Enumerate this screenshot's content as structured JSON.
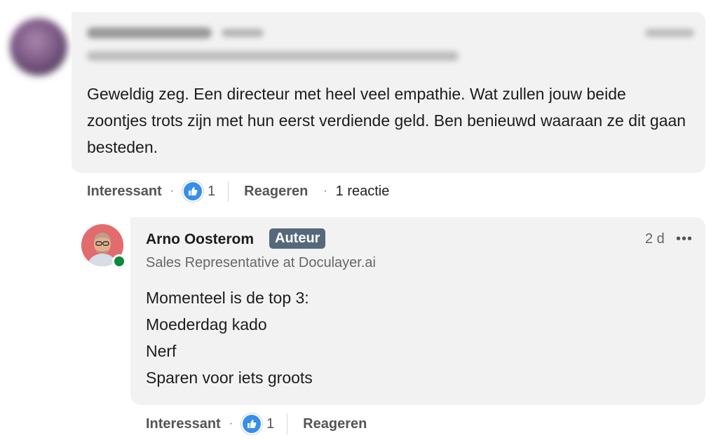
{
  "comment": {
    "text": "Geweldig zeg. Een directeur met heel veel empathie. Wat zullen jouw beide zoontjes trots zijn met hun eerst verdiende geld. Ben benieuwd waaraan ze dit gaan besteden.",
    "actions": {
      "like_label": "Interessant",
      "like_count": "1",
      "reply_label": "Reageren",
      "reply_count": "1 reactie"
    }
  },
  "reply": {
    "author_name": "Arno Oosterom",
    "author_badge": "Auteur",
    "headline": "Sales Representative at Doculayer.ai",
    "time": "2 d",
    "more": "•••",
    "lines": [
      "Momenteel is de top 3:",
      "Moederdag kado",
      "Nerf",
      "Sparen voor iets groots"
    ],
    "actions": {
      "like_label": "Interessant",
      "like_count": "1",
      "reply_label": "Reageren"
    }
  },
  "icons": {
    "like": "thumbs-up-icon",
    "more": "more-horizontal-icon"
  },
  "colors": {
    "like_badge": "#378fe9",
    "author_badge_bg": "#56687a",
    "online": "#0a8a3f"
  }
}
